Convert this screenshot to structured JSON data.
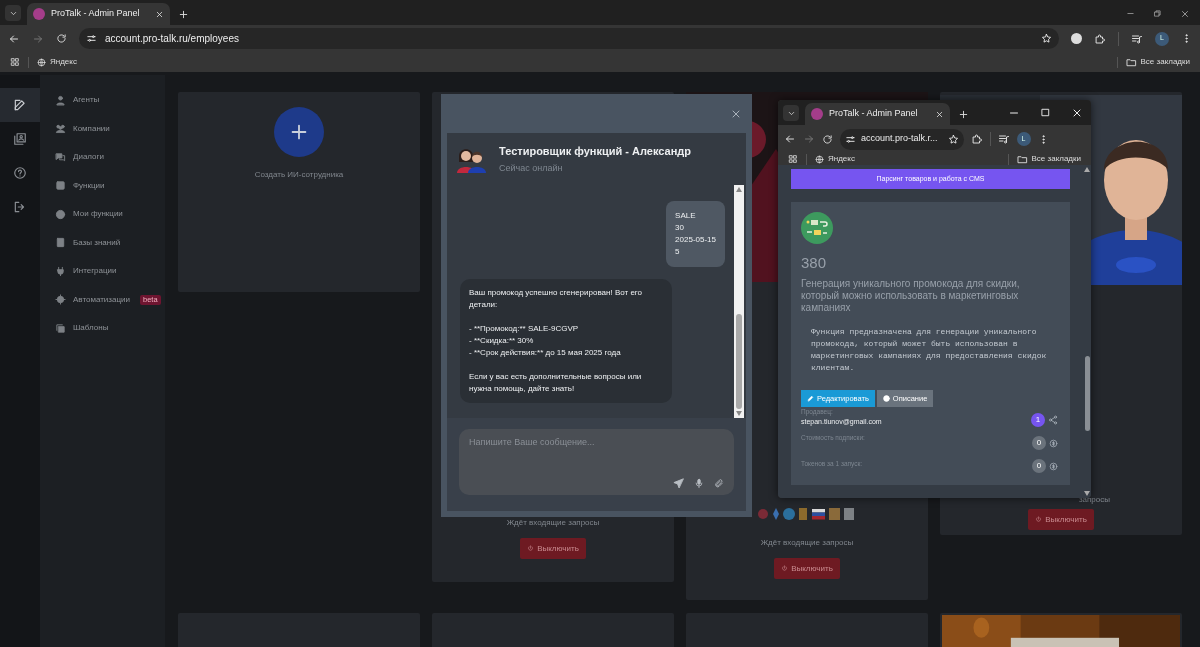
{
  "browser": {
    "tab_title": "ProTalk - Admin Panel",
    "url": "account.pro-talk.ru/employees",
    "bookmark": "Яндекс",
    "all_bookmarks": "Все закладки",
    "profile": "L"
  },
  "rail": [
    {
      "selected": true
    },
    {
      "selected": false
    },
    {
      "selected": false
    },
    {
      "selected": false
    }
  ],
  "sidebar": {
    "items": [
      {
        "label": "Агенты"
      },
      {
        "label": "Компании"
      },
      {
        "label": "Диалоги"
      },
      {
        "label": "Функции"
      },
      {
        "label": "Мои функции"
      },
      {
        "label": "Базы знаний"
      },
      {
        "label": "Интеграции"
      },
      {
        "label": "Автоматизации",
        "badge": "beta"
      },
      {
        "label": "Шаблоны"
      }
    ]
  },
  "create_card": {
    "label": "Создать ИИ-сотрудника"
  },
  "agent_cards": [
    {
      "status": "Ждёт входящие запросы",
      "button": "Выключить"
    },
    {
      "status": "Ждёт входящие запросы",
      "button": "Выключить"
    },
    {
      "status": "запросы",
      "button": "Выключить"
    }
  ],
  "chat": {
    "title": "Тестировщик функций - Александр",
    "status": "Сейчас онлайн",
    "placeholder": "Напишите Ваше сообщение...",
    "messages": [
      {
        "kind": "user",
        "text": "SALE\n30\n2025-05-15\n5"
      },
      {
        "kind": "bot",
        "text": "Ваш промокод успешно сгенерирован! Вот его детали:\n\n- **Промокод:** SALE-9CGVP\n- **Скидка:** 30%\n- **Срок действия:** до 15 мая 2025 года\n\nЕсли у вас есть дополнительные вопросы или нужна помощь, дайте знать!"
      }
    ]
  },
  "popup": {
    "tab_title": "ProTalk - Admin Panel",
    "url": "account.pro-talk.r...",
    "bookmark": "Яндекс",
    "all_bookmarks": "Все закладки",
    "profile": "L",
    "category_button": "Парсинг товаров и работа с CMS",
    "function": {
      "number": "380",
      "title": "Генерация уникального промокода для скидки, который можно использовать в маркетинговых кампаниях",
      "description": "Функция предназначена для генерации уникального промокода, который может быть использован в маркетинговых кампаниях для предоставления скидок клиентам.",
      "edit_button": "Редактировать",
      "description_button": "Описание",
      "seller_label": "Продавец:",
      "seller": "stepan.tiunov@gmail.com",
      "users": "1",
      "price_label": "Стоимость подписки:",
      "price": "0",
      "tokens_label": "Токенов за 1 запуск:",
      "tokens": "0"
    }
  }
}
